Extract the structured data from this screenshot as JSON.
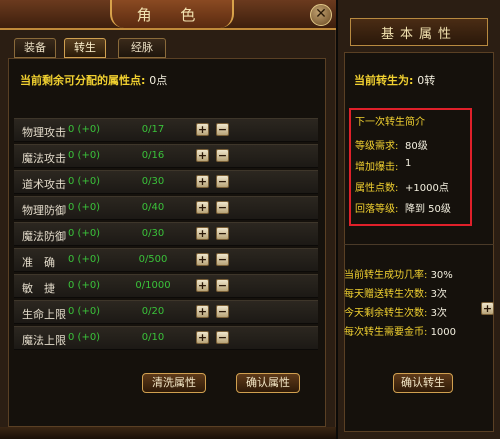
{
  "character_panel": {
    "title": "角 色",
    "close_icon": "close-icon",
    "tabs": [
      {
        "label": "装备",
        "active": false
      },
      {
        "label": "转生",
        "active": true
      },
      {
        "label": "经脉",
        "active": false
      }
    ],
    "free_points_label": "当前剩余可分配的属性点:",
    "free_points_value": "0点",
    "stats": [
      {
        "name": "物理攻击",
        "gain": "0 (+0)",
        "progress": "0/17"
      },
      {
        "name": "魔法攻击",
        "gain": "0 (+0)",
        "progress": "0/16"
      },
      {
        "name": "道术攻击",
        "gain": "0 (+0)",
        "progress": "0/30"
      },
      {
        "name": "物理防御",
        "gain": "0 (+0)",
        "progress": "0/40"
      },
      {
        "name": "魔法防御",
        "gain": "0 (+0)",
        "progress": "0/30"
      },
      {
        "name": "准　确",
        "gain": "0 (+0)",
        "progress": "0/500"
      },
      {
        "name": "敏　捷",
        "gain": "0 (+0)",
        "progress": "0/1000"
      },
      {
        "name": "生命上限",
        "gain": "0 (+0)",
        "progress": "0/20"
      },
      {
        "name": "魔法上限",
        "gain": "0 (+0)",
        "progress": "0/10"
      }
    ],
    "plus_symbol": "+",
    "minus_symbol": "−",
    "clear_button": "清洗属性",
    "confirm_button": "确认属性"
  },
  "attribute_panel": {
    "title": "基本属性",
    "rebirth_label": "当前转生为:",
    "rebirth_value": "0转",
    "next_title": "下一次转生简介",
    "next_items": [
      {
        "key": "等级需求:",
        "value": "80级"
      },
      {
        "key": "增加爆击:",
        "value": "1"
      },
      {
        "key": "属性点数:",
        "value": "+1000点"
      },
      {
        "key": "回落等级:",
        "value": "降到  50级"
      }
    ],
    "info_items": [
      {
        "key": "当前转生成功几率:",
        "value": "30%"
      },
      {
        "key": "每天赠送转生次数:",
        "value": "3次"
      },
      {
        "key": "今天剩余转生次数:",
        "value": "3次"
      },
      {
        "key": "每次转生需要金币:",
        "value": "1000"
      }
    ],
    "plus_symbol": "+",
    "confirm_rebirth_button": "确认转生"
  }
}
